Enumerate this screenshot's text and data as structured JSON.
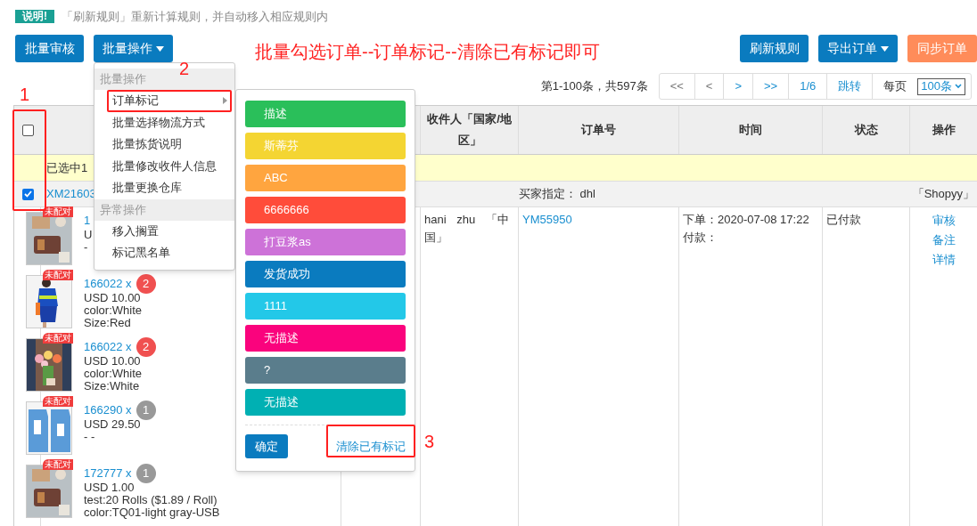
{
  "notice": {
    "badge": "说明!",
    "text": "「刷新规则」重新计算规则，并自动移入相应规则内"
  },
  "toolbar_left": [
    {
      "label": "批量审核",
      "kind": "primary",
      "dropdown": false
    },
    {
      "label": "批量操作",
      "kind": "primary",
      "dropdown": true
    }
  ],
  "instruction": "批量勾选订单--订单标记--清除已有标记即可",
  "toolbar_right": [
    {
      "label": "刷新规则",
      "kind": "primary",
      "dropdown": false
    },
    {
      "label": "导出订单",
      "kind": "primary",
      "dropdown": true
    },
    {
      "label": "同步订单",
      "kind": "warning",
      "dropdown": false
    }
  ],
  "pagination": {
    "summary": "第1-100条，共597条",
    "buttons": [
      "<<",
      "<",
      ">",
      ">>",
      "1/6",
      "跳转"
    ],
    "per_page_label": "每页",
    "per_page_value": "100条"
  },
  "table": {
    "select_all_checked": false,
    "columns": [
      "收件人「国家/地区」",
      "订单号",
      "时间",
      "状态",
      "操作"
    ],
    "selection_note": "已选中1",
    "order": {
      "checked": true,
      "id": "XM21603",
      "shipping": "买家指定： dhl",
      "store": "「Shopyy」",
      "products": [
        {
          "tag": "未配对",
          "sku": "1",
          "lines": [
            "U",
            "-"
          ]
        },
        {
          "tag": "未配对",
          "sku": "166022 x",
          "qty": "2",
          "color": "#f05050",
          "lines": [
            "USD 10.00",
            "color:White",
            "Size:Red"
          ]
        },
        {
          "tag": "未配对",
          "sku": "166022 x",
          "qty": "2",
          "color": "#f05050",
          "lines": [
            "USD 10.00",
            "color:White",
            "Size:White"
          ]
        },
        {
          "tag": "未配对",
          "sku": "166290 x",
          "qty": "1",
          "color": "#999999",
          "lines": [
            "USD 29.50",
            "- -"
          ]
        },
        {
          "tag": "未配对",
          "sku": "172777 x",
          "qty": "1",
          "color": "#999999",
          "lines": [
            "USD 1.00",
            "test:20 Rolls ($1.89 / Roll)",
            "color:TQ01-light gray-USB"
          ]
        }
      ],
      "recipient": "hani zhu 「中国」",
      "order_no": "YM55950",
      "times": [
        "下单：2020-07-08 17:22",
        "付款："
      ],
      "status": "已付款",
      "actions": [
        "审核",
        "备注",
        "详情"
      ]
    }
  },
  "menu": {
    "sections": [
      {
        "header": "批量操作",
        "items": [
          {
            "label": "订单标记",
            "submenu": true
          },
          {
            "label": "批量选择物流方式",
            "submenu": false
          },
          {
            "label": "批量拣货说明",
            "submenu": false
          },
          {
            "label": "批量修改收件人信息",
            "submenu": false
          },
          {
            "label": "批量更换仓库",
            "submenu": false
          }
        ]
      },
      {
        "header": "异常操作",
        "items": [
          {
            "label": "移入搁置",
            "submenu": false
          },
          {
            "label": "标记黑名单",
            "submenu": false
          }
        ]
      }
    ]
  },
  "tag_menu": {
    "tags": [
      {
        "label": "描述",
        "color": "#2abf5a"
      },
      {
        "label": "斯蒂芬",
        "color": "#f4d532"
      },
      {
        "label": "ABC",
        "color": "#ffa53f"
      },
      {
        "label": "6666666",
        "color": "#ff4c3a"
      },
      {
        "label": "打豆浆as",
        "color": "#cd72d8"
      },
      {
        "label": "发货成功",
        "color": "#0a7bbf"
      },
      {
        "label": "1111",
        "color": "#23c8e8"
      },
      {
        "label": "无描述",
        "color": "#fa037d"
      },
      {
        "label": "?",
        "color": "#5a7d8c"
      },
      {
        "label": "无描述",
        "color": "#00b0b3"
      }
    ],
    "confirm": "确定",
    "clear": "清除已有标记"
  },
  "step_marks": [
    "1",
    "2",
    "3"
  ]
}
